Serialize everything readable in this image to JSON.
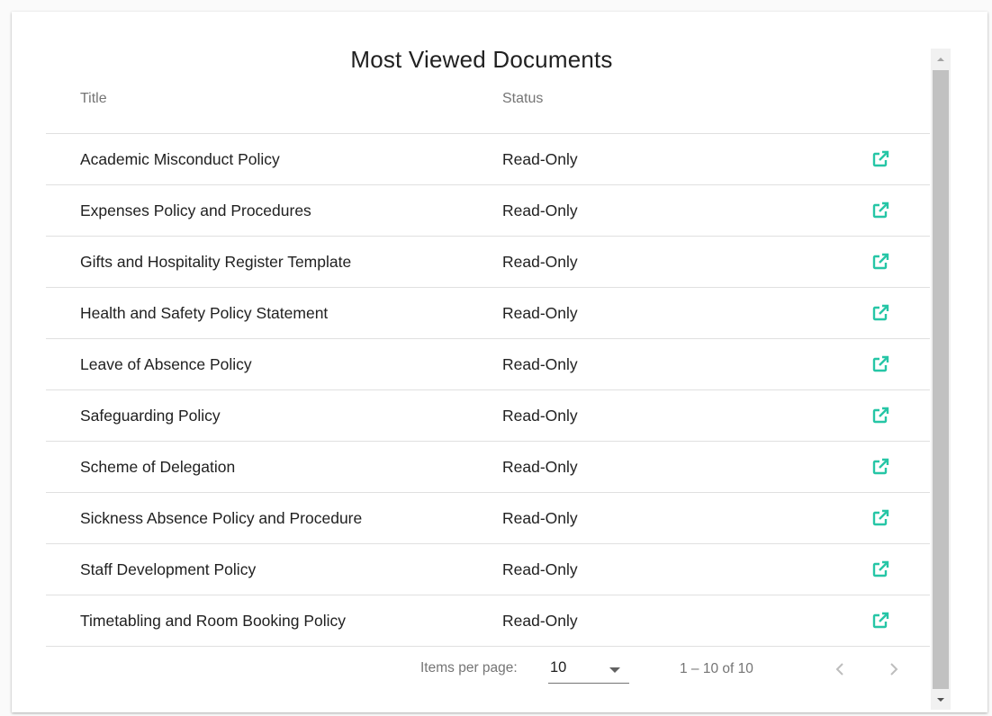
{
  "widget": {
    "title": "Most Viewed Documents"
  },
  "table": {
    "headers": {
      "title": "Title",
      "status": "Status"
    },
    "rows": [
      {
        "title": "Academic Misconduct Policy",
        "status": "Read-Only"
      },
      {
        "title": "Expenses Policy and Procedures",
        "status": "Read-Only"
      },
      {
        "title": "Gifts and Hospitality Register Template",
        "status": "Read-Only"
      },
      {
        "title": "Health and Safety Policy Statement",
        "status": "Read-Only"
      },
      {
        "title": "Leave of Absence Policy",
        "status": "Read-Only"
      },
      {
        "title": "Safeguarding Policy",
        "status": "Read-Only"
      },
      {
        "title": "Scheme of Delegation",
        "status": "Read-Only"
      },
      {
        "title": "Sickness Absence Policy and Procedure",
        "status": "Read-Only"
      },
      {
        "title": "Staff Development Policy",
        "status": "Read-Only"
      },
      {
        "title": "Timetabling and Room Booking Policy",
        "status": "Read-Only"
      }
    ],
    "row_action_icon": "open-in-new-icon",
    "accent_color": "#26c6a6"
  },
  "paginator": {
    "items_per_page_label": "Items per page:",
    "items_per_page_value": "10",
    "range_label": "1 – 10 of 10",
    "prev_icon": "chevron-left-icon",
    "next_icon": "chevron-right-icon"
  }
}
